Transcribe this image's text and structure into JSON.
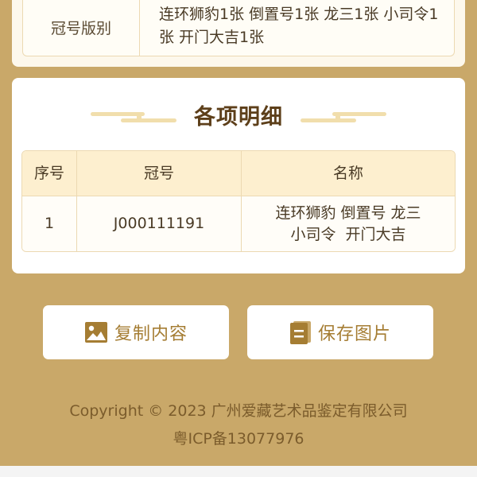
{
  "top_card": {
    "label": "冠号版别",
    "value_line1": "连环狮豹1张 倒置号1张 龙三1张 小司令1",
    "value_line2": "张 开门大吉1张"
  },
  "detail": {
    "title": "各项明细",
    "columns": [
      "序号",
      "冠号",
      "名称"
    ],
    "rows": [
      {
        "index": "1",
        "serial": "J000111191",
        "name_line1": "连环狮豹 倒置号 龙三",
        "name_line2": "小司令  开门大吉"
      }
    ]
  },
  "buttons": {
    "copy_label": "复制内容",
    "copy_icon": "image-icon",
    "save_label": "保存图片",
    "save_icon": "document-icon"
  },
  "footer": {
    "copyright": "Copyright © 2023 广州爱藏艺术品鉴定有限公司",
    "icp": "粤ICP备13077976"
  },
  "colors": {
    "background": "#c9a869",
    "accent": "#a57d33",
    "title": "#5d3f1a",
    "table_header": "#fdefcf"
  }
}
